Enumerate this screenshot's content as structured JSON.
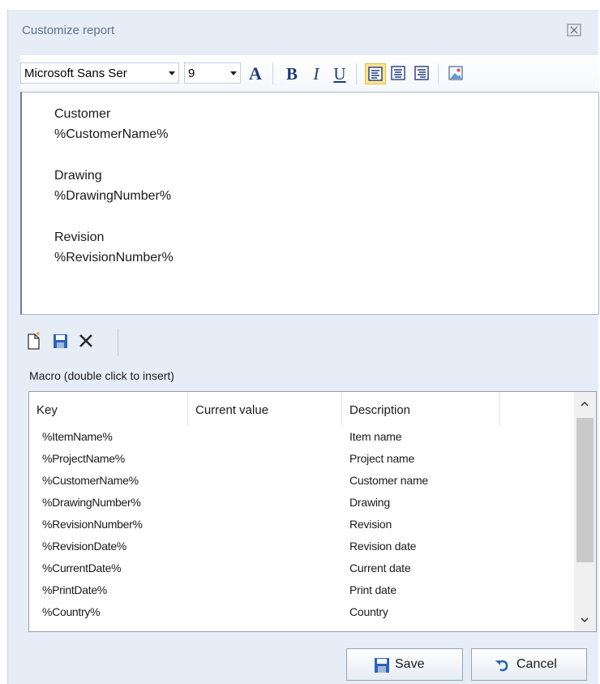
{
  "window": {
    "title": "Customize report",
    "close_icon": "close-icon"
  },
  "format_toolbar": {
    "font_family": "Microsoft Sans Ser",
    "font_size": "9",
    "buttons": [
      "font-color",
      "bold",
      "italic",
      "underline",
      "align-left",
      "align-center",
      "align-right",
      "insert-image"
    ],
    "active": "align-left",
    "bold_label": "B",
    "italic_label": "I",
    "underline_label": "U",
    "font_color_label": "A"
  },
  "editor": {
    "lines": [
      "Customer",
      "%CustomerName%",
      "",
      "Drawing",
      "%DrawingNumber%",
      "",
      "Revision",
      "%RevisionNumber%"
    ]
  },
  "file_toolbar": {
    "icons": [
      "new-document-icon",
      "save-icon",
      "delete-icon"
    ]
  },
  "macros": {
    "label": "Macro (double click to insert)",
    "columns": [
      "Key",
      "Current value",
      "Description"
    ],
    "rows": [
      {
        "key": "%ItemName%",
        "value": "",
        "description": "Item name"
      },
      {
        "key": "%ProjectName%",
        "value": "",
        "description": "Project name"
      },
      {
        "key": "%CustomerName%",
        "value": "",
        "description": "Customer name"
      },
      {
        "key": "%DrawingNumber%",
        "value": "",
        "description": "Drawing"
      },
      {
        "key": "%RevisionNumber%",
        "value": "",
        "description": "Revision"
      },
      {
        "key": "%RevisionDate%",
        "value": "",
        "description": "Revision date"
      },
      {
        "key": "%CurrentDate%",
        "value": "",
        "description": "Current date"
      },
      {
        "key": "%PrintDate%",
        "value": "",
        "description": "Print date"
      },
      {
        "key": "%Country%",
        "value": "",
        "description": "Country"
      }
    ]
  },
  "buttons": {
    "save": "Save",
    "cancel": "Cancel"
  },
  "colors": {
    "dialog_bg": "#e7edf6",
    "active_button": "#ffe58f",
    "title": "#5a7592"
  }
}
